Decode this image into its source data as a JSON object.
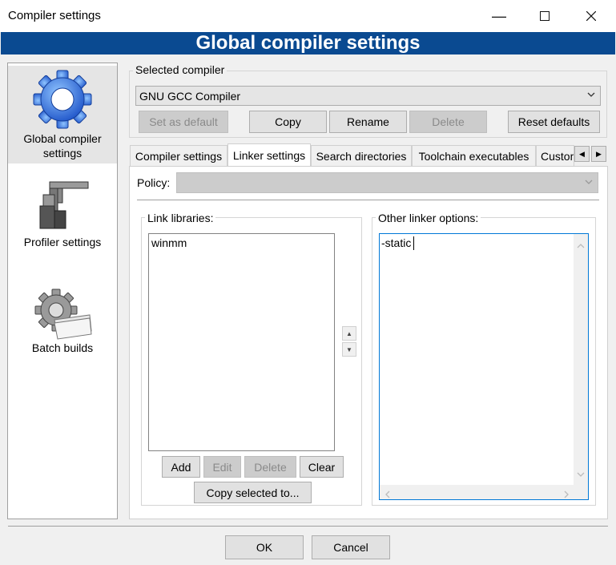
{
  "window": {
    "title": "Compiler settings",
    "banner": "Global compiler settings"
  },
  "sidebar": {
    "items": [
      {
        "label1": "Global compiler",
        "label2": "settings",
        "icon": "gear-icon"
      },
      {
        "label1": "Profiler settings",
        "icon": "caliper-icon"
      },
      {
        "label1": "Batch builds",
        "icon": "batch-gear-icon"
      }
    ]
  },
  "selected_compiler": {
    "group_label": "Selected compiler",
    "value": "GNU GCC Compiler",
    "buttons": {
      "set_default": "Set as default",
      "copy": "Copy",
      "rename": "Rename",
      "delete": "Delete",
      "reset": "Reset defaults"
    }
  },
  "tabs": [
    "Compiler settings",
    "Linker settings",
    "Search directories",
    "Toolchain executables",
    "Custom"
  ],
  "policy": {
    "label": "Policy:",
    "value": ""
  },
  "link_libraries": {
    "label": "Link libraries:",
    "items": [
      "winmm"
    ],
    "buttons": {
      "add": "Add",
      "edit": "Edit",
      "delete": "Delete",
      "clear": "Clear",
      "copy_selected": "Copy selected to..."
    }
  },
  "other_options": {
    "label": "Other linker options:",
    "value": "-static"
  },
  "footer": {
    "ok": "OK",
    "cancel": "Cancel"
  },
  "colors": {
    "banner": "#0a4a91",
    "focus_border": "#0078d7"
  }
}
